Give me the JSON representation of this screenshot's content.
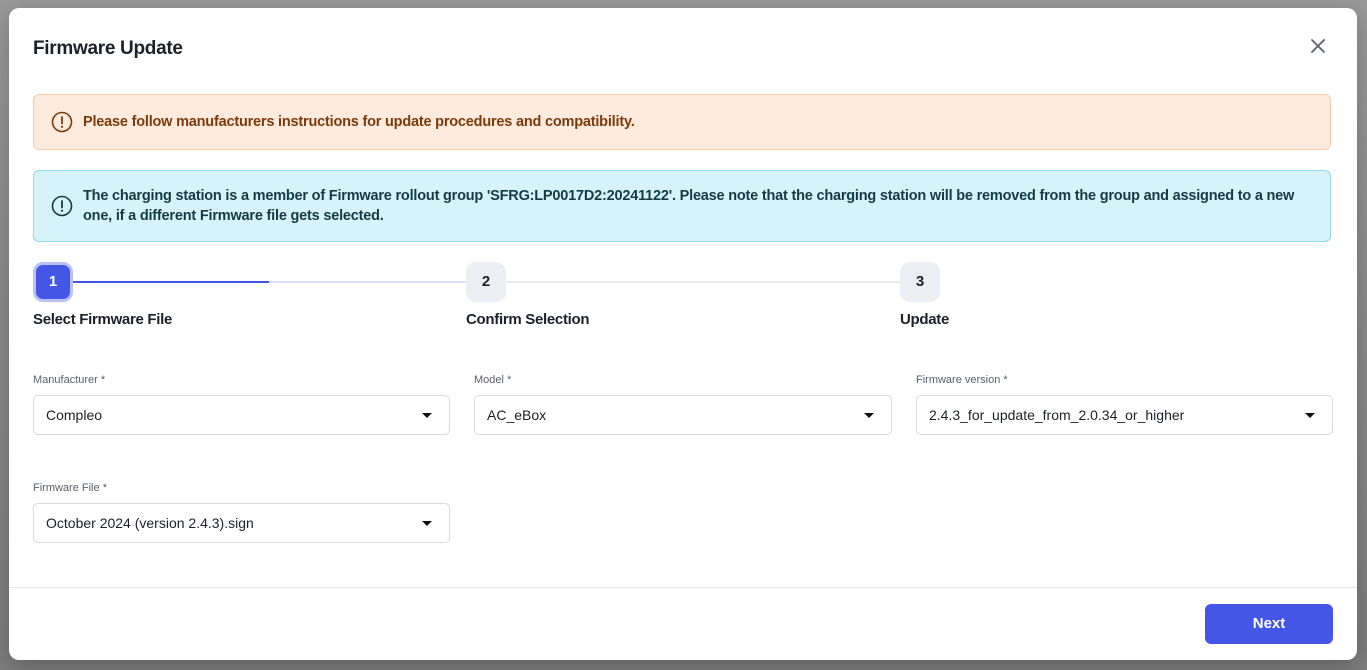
{
  "dialog": {
    "title": "Firmware Update"
  },
  "alerts": {
    "warning": "Please follow manufacturers instructions for update procedures and compatibility.",
    "info": "The charging station is a member of Firmware rollout group 'SFRG:LP0017D2:20241122'. Please note that the charging station will be removed from the group and assigned to a new one, if a different Firmware file gets selected."
  },
  "stepper": {
    "steps": [
      {
        "number": "1",
        "label": "Select Firmware File",
        "state": "active"
      },
      {
        "number": "2",
        "label": "Confirm Selection",
        "state": "pending"
      },
      {
        "number": "3",
        "label": "Update",
        "state": "pending"
      }
    ]
  },
  "form": {
    "manufacturer": {
      "label": "Manufacturer",
      "required_mark": "*",
      "value": "Compleo"
    },
    "model": {
      "label": "Model",
      "required_mark": "*",
      "value": "AC_eBox"
    },
    "firmware_version": {
      "label": "Firmware version",
      "required_mark": "*",
      "value": "2.4.3_for_update_from_2.0.34_or_higher"
    },
    "firmware_file": {
      "label": "Firmware File",
      "required_mark": "*",
      "value": "October 2024 (version 2.4.3).sign"
    }
  },
  "footer": {
    "next_label": "Next"
  },
  "icons": {
    "close": "close-icon",
    "alert": "exclamation-circle-icon",
    "dropdown": "caret-down-icon"
  },
  "colors": {
    "primary": "#4356e6",
    "warning_bg": "#feebdd",
    "warning_text": "#7a3a0a",
    "info_bg": "#d6f3f9",
    "info_text": "#133a45"
  }
}
